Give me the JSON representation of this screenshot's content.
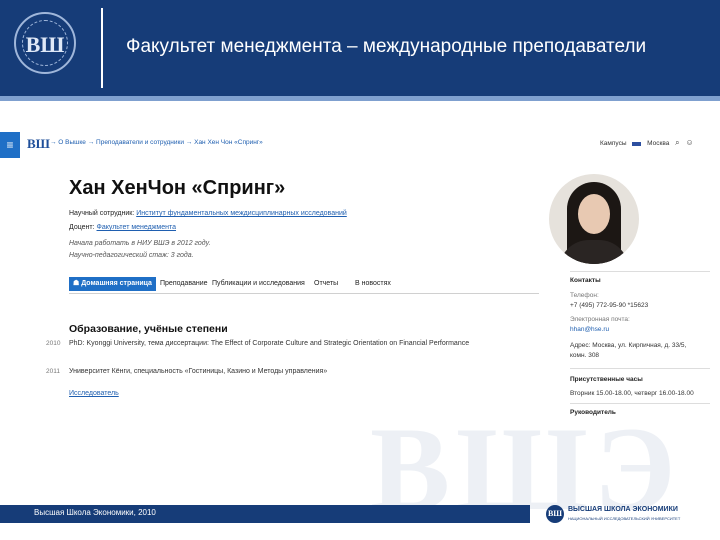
{
  "slide": {
    "title": "Факультет менеджмента – международные преподаватели",
    "logo_text": "ВШ"
  },
  "browser": {
    "menu_icon": "≡",
    "logo_text": "ВШ",
    "breadcrumb": "→ О Вышке → Преподаватели и сотрудники → Хан Хен Чон «Спринг»",
    "region": "Кампусы",
    "city": "Москва",
    "icons": [
      "search-icon",
      "user-icon"
    ]
  },
  "profile": {
    "name": "Хан ХенЧон «Спринг»",
    "role1_key": "Научный сотрудник:",
    "role1_value": "Институт фундаментальных междисциплинарных исследований",
    "role2_key": "Доцент:",
    "role2_value": "Факультет менеджмента",
    "note1": "Начала работать в НИУ ВШЭ в 2012 году.",
    "note2": "Научно-педагогический стаж: 3 года."
  },
  "tabs": [
    {
      "label": "☗ Домашняя страница",
      "active": true
    },
    {
      "label": "Преподавание",
      "active": false
    },
    {
      "label": "Публикации и исследования",
      "active": false
    },
    {
      "label": "Отчеты",
      "active": false
    },
    {
      "label": "В новостях",
      "active": false
    }
  ],
  "education": {
    "title": "Образование, учёные степени",
    "items": [
      {
        "year": "2010",
        "text": "PhD: Kyonggi University, тема диссертации: The Effect of Corporate Culture and Strategic Orientation on Financial Performance"
      },
      {
        "year": "2011",
        "text": "Университет Кёнги, специальность «Гостиницы, Казино и Методы управления»"
      }
    ],
    "link": "Исследователь"
  },
  "contacts": {
    "title": "Контакты",
    "phone_label": "Телефон:",
    "phone": "+7 (495) 772-95-90 *15623",
    "email_label": "Электронная почта:",
    "email": "hhan@hse.ru",
    "address_line1": "Адрес: Москва, ул. Кирпичная, д. 33/5,",
    "address_line2": "комн. 308",
    "hours_title": "Присутственные часы",
    "hours": "Вторник 15.00-18.00, четверг 16.00-18.00",
    "manager_title": "Руководитель"
  },
  "watermark": "ВШЭ",
  "footer": {
    "text": "Высшая Школа Экономики, 2010",
    "logo_text": "ВШ",
    "org": "ВЫСШАЯ ШКОЛА ЭКОНОМИКИ",
    "org_sub": "НАЦИОНАЛЬНЫЙ ИССЛЕДОВАТЕЛЬСКИЙ УНИВЕРСИТЕТ"
  }
}
